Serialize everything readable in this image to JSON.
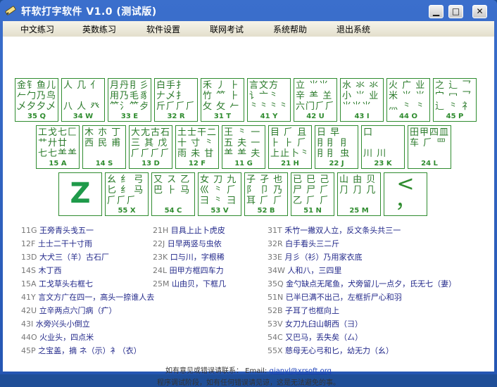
{
  "window": {
    "title": "轩软打字软件 V1.0 (测试版)",
    "min": "▁",
    "max": "□",
    "close": "✕"
  },
  "menu": [
    "中文练习",
    "英数练习",
    "软件设置",
    "联网考试",
    "系统帮助",
    "退出系统"
  ],
  "row1": [
    {
      "glyphs": "金钅鱼儿\n𠂉勹乃鸟\n乄夕夕乄",
      "code": "35 Q"
    },
    {
      "glyphs": "人 几 亻\n\n八 人 癶",
      "code": "34 W"
    },
    {
      "glyphs": "月丹⺝彡\n用乃毛豸\n⺮⺡⺮⺞",
      "code": "33 E"
    },
    {
      "glyphs": "白手扌\n𠂇乄扌\n斤⺁⺁⺁",
      "code": "32 R"
    },
    {
      "glyphs": "禾 丿 ⺊\n竹 ⺮ ⺊\n攵 攵 𠂉",
      "code": "31 T"
    },
    {
      "glyphs": "言文方\n讠亠⺀\n⺀⺀⺀⺀",
      "code": "41 Y"
    },
    {
      "glyphs": "立 ⺌⺌\n辛 ⺷ 𦍌\n六门⺁⺁",
      "code": "42 U"
    },
    {
      "glyphs": "水 氺 氺\n小 ⺌ 业\n⺌⺌⺌",
      "code": "43 I"
    },
    {
      "glyphs": "火 广 业\n米 ⺌ ⺌\n灬 ⺀ ⺀",
      "code": "44 O"
    },
    {
      "glyphs": "之 辶 乛\n宀 冖 乛\n⻌ ⺀ 礻",
      "code": "45 P"
    }
  ],
  "row2": [
    {
      "glyphs": "工戈七匚\n⺾廾廿\n七七⺷⺷",
      "code": "15 A"
    },
    {
      "glyphs": "木 朩 丁\n西 ⺠ 甫",
      "code": "14 S"
    },
    {
      "glyphs": "大尢古石\n三 其 戊\n⺁⺁⺁⺁",
      "code": "13 D"
    },
    {
      "glyphs": "土士干二\n十 寸 ⺀\n雨 未 甘",
      "code": "12 F"
    },
    {
      "glyphs": "王 ⺀ 一\n五 夫 一\n⺷ ⺷ 夫",
      "code": "11 G"
    },
    {
      "glyphs": "目 ⺁ 且\n⺊ ⺊ ⺁\n上止卜⺀",
      "code": "21 H"
    },
    {
      "glyphs": "日 早\n⺝⺝ ⺝\n⺝⺝ 虫",
      "code": "22 J"
    },
    {
      "glyphs": "口\n\n川 川",
      "code": "23 K"
    },
    {
      "glyphs": "田甲四皿\n车 ⺁ 罒",
      "code": "24 L"
    }
  ],
  "row3": [
    {
      "glyphs": "",
      "code": "",
      "big": "Z"
    },
    {
      "glyphs": "幺 纟 弓\n匕 纟 马\n⺁⺁⺁",
      "code": "55 X"
    },
    {
      "glyphs": "又 ス 乙\n巴 ⺊ 马",
      "code": "54 C"
    },
    {
      "glyphs": "女 刀 九\n巛 ⺀ ⺁\n彐 ⺀ 彐",
      "code": "53 V"
    },
    {
      "glyphs": "子 孑 也\n阝 卩 乃\n耳 ⺁ ⺁",
      "code": "52 B"
    },
    {
      "glyphs": "已 巳 己\n尸 尸 ⺁\n乙 ⺁ ⺁",
      "code": "51 N"
    },
    {
      "glyphs": "山 由 贝\n⺆ ⺆ 几",
      "code": "25 M"
    },
    {
      "glyphs": "",
      "code": "",
      "punct": "<\n，"
    }
  ],
  "help_left": [
    {
      "code": "11G",
      "text": "王旁青头戋五一"
    },
    {
      "code": "12F",
      "text": "土士二干十寸雨"
    },
    {
      "code": "13D",
      "text": "大犬三（羊）古石厂"
    },
    {
      "code": "14S",
      "text": "木丁西"
    },
    {
      "code": "15A",
      "text": "工戈草头右框七"
    },
    {
      "code": "41Y",
      "text": "言文方广在四一，高头一捺谁人去"
    },
    {
      "code": "42U",
      "text": "立辛两点六门病（疒）"
    },
    {
      "code": "43I",
      "text": "水旁兴头小倒立"
    },
    {
      "code": "44O",
      "text": "火业头，四点米"
    },
    {
      "code": "45P",
      "text": "之宝盖，摘 ネ（示）衤（衣）"
    }
  ],
  "help_mid": [
    {
      "code": "21H",
      "text": "目具上止卜虎皮"
    },
    {
      "code": "22J",
      "text": "日早两竖与虫依"
    },
    {
      "code": "23K",
      "text": "口与川，字根稀"
    },
    {
      "code": "24L",
      "text": "田甲方框四车力"
    },
    {
      "code": "25M",
      "text": "山由贝，下框几"
    }
  ],
  "help_right": [
    {
      "code": "31T",
      "text": "禾竹一撇双人立，反文条头共三一"
    },
    {
      "code": "32R",
      "text": "白手看头三二斤"
    },
    {
      "code": "33E",
      "text": "月彡（衫）乃用家衣底"
    },
    {
      "code": "34W",
      "text": "人和八，三四里"
    },
    {
      "code": "35Q",
      "text": "金勺缺点无尾鱼，犬旁留儿一点夕，氏无七（妻）"
    },
    {
      "code": "51N",
      "text": "已半巳满不出己，左框折尸心和羽"
    },
    {
      "code": "52B",
      "text": "子耳了也框向上"
    },
    {
      "code": "53V",
      "text": "女刀九臼山朝西（彐）"
    },
    {
      "code": "54C",
      "text": "又巴马，丢失矣（厶）"
    },
    {
      "code": "55X",
      "text": "慈母无心弓和匕，幼无力（幺）"
    }
  ],
  "footer": {
    "line1_prefix": "如有意见或错误请联系： Email:",
    "email": "gianyl@xrsoft.org",
    "line2": "程序调试阶段，如有任何错误请见谅，这是无法避免的事。"
  }
}
